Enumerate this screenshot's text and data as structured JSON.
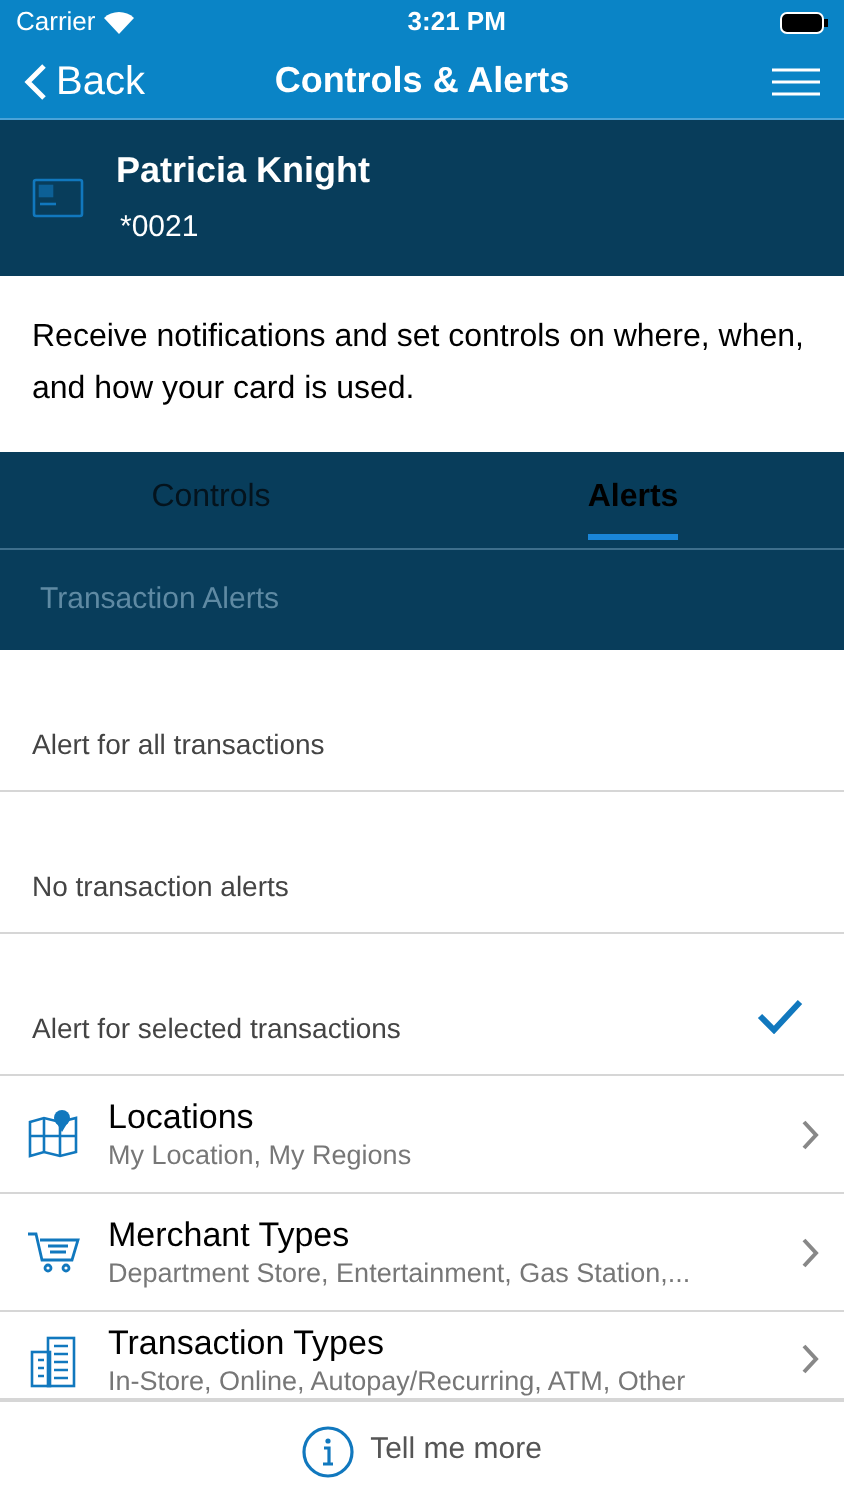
{
  "status_bar": {
    "carrier": "Carrier",
    "time": "3:21 PM"
  },
  "nav": {
    "back": "Back",
    "title": "Controls & Alerts"
  },
  "card": {
    "name": "Patricia Knight",
    "number": "*0021"
  },
  "description": "Receive notifications and set controls on where, when, and how your card is used.",
  "tabs": [
    {
      "label": "Controls",
      "selected": false
    },
    {
      "label": "Alerts",
      "selected": true
    }
  ],
  "section_header": "Transaction Alerts",
  "options": [
    {
      "label": "Alert for all transactions",
      "selected": false
    },
    {
      "label": "No transaction alerts",
      "selected": false
    },
    {
      "label": "Alert for selected transactions",
      "selected": true
    }
  ],
  "rows": [
    {
      "kind": "map",
      "title": "Locations",
      "subtitle": "My Location, My Regions"
    },
    {
      "kind": "cart",
      "title": "Merchant Types",
      "subtitle": "Department Store, Entertainment, Gas Station,..."
    },
    {
      "kind": "building",
      "title": "Transaction Types",
      "subtitle": "In-Store, Online, Autopay/Recurring, ATM, Other"
    }
  ],
  "footer": {
    "link": "Tell me more"
  }
}
